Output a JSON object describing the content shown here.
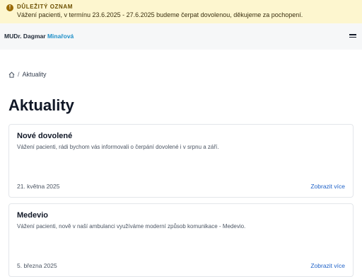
{
  "notice": {
    "icon": "exclamation-icon",
    "title": "DŮLEŽITÝ OZNAM",
    "text": "Vážení pacienti, v termínu 23.6.2025 - 27.6.2025 budeme čerpat dovolenou, děkujeme za pochopení.",
    "background": "#fdf6cf"
  },
  "header": {
    "brand_first": "MUDr. Dagmar",
    "brand_last": "Minařová",
    "brand_accent_color": "#1e8fc8",
    "menu_icon": "hamburger-icon"
  },
  "breadcrumb": {
    "home_icon": "home-icon",
    "separator": "/",
    "current": "Aktuality"
  },
  "page_title": "Aktuality",
  "articles": [
    {
      "title": "Nové dovolené",
      "excerpt": "Vážení pacienti, rádi bychom vás informovali o čerpání dovolené i v srpnu a září.",
      "date": "21. května 2025",
      "more": "Zobrazit více"
    },
    {
      "title": "Medevio",
      "excerpt": "Vážení pacienti, nově v naší ambulanci využíváme moderní způsob komunikace - Medevio.",
      "date": "5. března 2025",
      "more": "Zobrazit více"
    }
  ]
}
